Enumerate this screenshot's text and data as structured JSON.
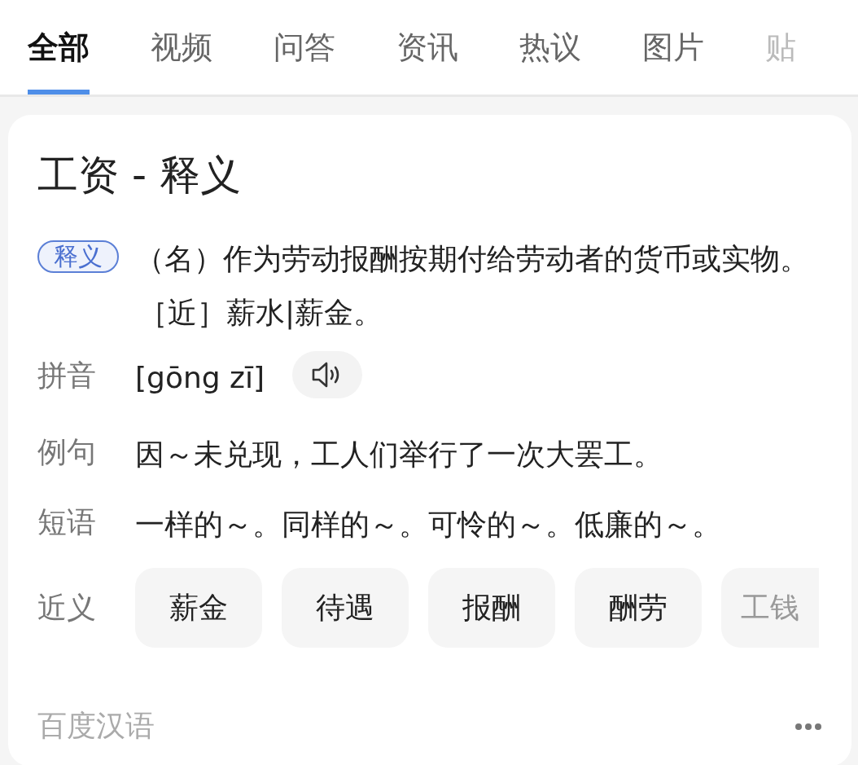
{
  "tabs": [
    {
      "label": "全部",
      "selected": true
    },
    {
      "label": "视频",
      "selected": false
    },
    {
      "label": "问答",
      "selected": false
    },
    {
      "label": "资讯",
      "selected": false
    },
    {
      "label": "热议",
      "selected": false
    },
    {
      "label": "图片",
      "selected": false
    },
    {
      "label": "贴",
      "selected": false
    }
  ],
  "card": {
    "title": "工资 - 释义",
    "definition": {
      "tag": "释义",
      "text": "（名）作为劳动报酬按期付给劳动者的货币或实物。［近］薪水|薪金。"
    },
    "pinyin": {
      "label": "拼音",
      "text": "[gōng zī]"
    },
    "example": {
      "label": "例句",
      "text": "因～未兑现，工人们举行了一次大罢工。"
    },
    "phrases": {
      "label": "短语",
      "text": "一样的～。同样的～。可怜的～。低廉的～。"
    },
    "synonyms": {
      "label": "近义",
      "items": [
        "薪金",
        "待遇",
        "报酬",
        "酬劳",
        "工钱"
      ]
    },
    "source": "百度汉语"
  }
}
